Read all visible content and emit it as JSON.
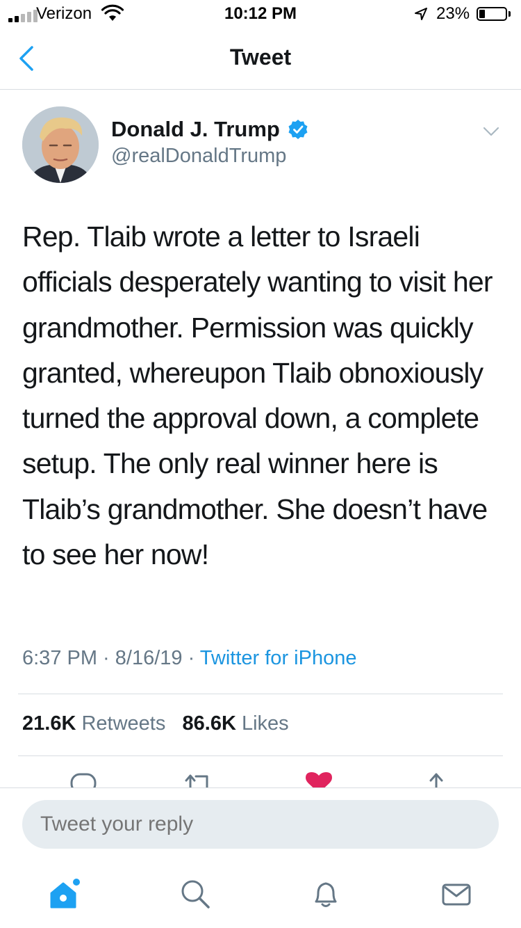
{
  "status_bar": {
    "carrier": "Verizon",
    "time": "10:12 PM",
    "battery": "23%",
    "battery_level": 0.23,
    "signal_bars": 2
  },
  "header": {
    "title": "Tweet",
    "back_icon": "chevron-left-icon"
  },
  "tweet": {
    "author_name": "Donald J. Trump",
    "author_handle": "@realDonaldTrump",
    "verified": true,
    "text": "Rep. Tlaib wrote a letter to Israeli officials desperately wanting to visit her grandmother. Permission was quickly granted, whereupon Tlaib obnoxiously turned the approval down, a complete setup. The only real winner here is Tlaib’s grandmother. She doesn’t have to see her now!",
    "time": "6:37 PM",
    "date": "8/16/19",
    "separator": " · ",
    "source": "Twitter for iPhone",
    "retweets_count": "21.6K",
    "retweets_label": "Retweets",
    "likes_count": "86.6K",
    "likes_label": "Likes"
  },
  "reply": {
    "placeholder": "Tweet your reply"
  },
  "tabs": [
    {
      "icon": "home-icon",
      "active": true
    },
    {
      "icon": "search-icon",
      "active": false
    },
    {
      "icon": "bell-icon",
      "active": false
    },
    {
      "icon": "mail-icon",
      "active": false
    }
  ],
  "colors": {
    "accent": "#1da1f2",
    "link": "#1b95e0",
    "secondary_text": "#657786",
    "like": "#e0245e",
    "divider": "#d8dde1",
    "reply_bg": "#e6ecf0"
  }
}
